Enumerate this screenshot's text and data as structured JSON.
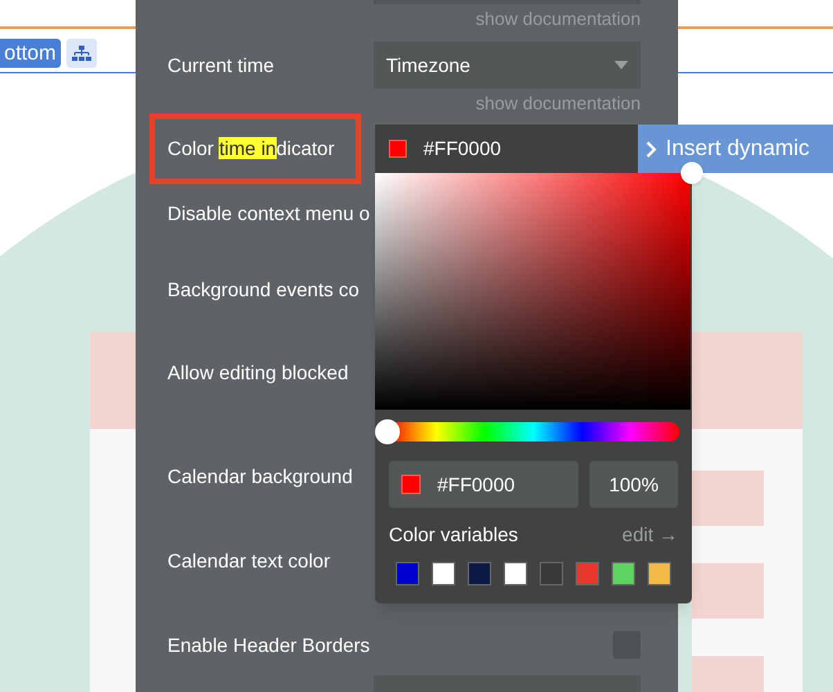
{
  "toolbar": {
    "button_label": "ottom"
  },
  "panel": {
    "top_doc": "show documentation",
    "current_time": {
      "label": "Current time",
      "value": "Timezone",
      "doc": "show documentation"
    },
    "color_row": {
      "label_parts": [
        {
          "text": "Color ",
          "highlighted": false
        },
        {
          "text": "time in",
          "highlighted": true
        },
        {
          "text": "dicator",
          "highlighted": false
        }
      ],
      "outlined": true,
      "value": "#FF0000"
    },
    "rows": [
      {
        "label": "Disable context menu o",
        "kind": "plain"
      },
      {
        "label": "Background events co",
        "kind": "plain"
      },
      {
        "label": "Allow editing blocked",
        "kind": "plain"
      },
      {
        "label": "Calendar background",
        "kind": "plain"
      },
      {
        "label": "Calendar text color",
        "kind": "plain"
      },
      {
        "label": "Enable Header Borders",
        "kind": "checkbox",
        "checked": false
      }
    ]
  },
  "dynamic_tab": {
    "label": "Insert dynamic"
  },
  "color_picker": {
    "hue": {
      "level": 0
    },
    "hex": "#FF0000",
    "opacity": "100%",
    "variables_title": "Color variables",
    "edit_link": "edit →",
    "variables": [
      {
        "color": "#0000cc"
      },
      {
        "color": "#ffffff"
      },
      {
        "color": "#0c1a47"
      },
      {
        "color": "#ffffff"
      },
      {
        "color": "#3a3a3a"
      },
      {
        "color": "#e8372b"
      },
      {
        "color": "#5fd35f"
      },
      {
        "color": "#f2ba45"
      }
    ]
  }
}
